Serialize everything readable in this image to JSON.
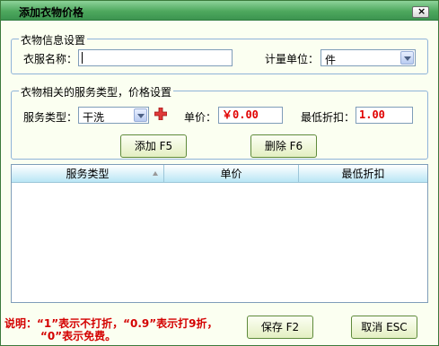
{
  "window": {
    "title": "添加衣物价格",
    "close_label": "×"
  },
  "info_group": {
    "title": "衣物信息设置",
    "name_label": "衣服名称：",
    "name_value": "",
    "unit_label": "计量单位：",
    "unit_value": "件"
  },
  "service_group": {
    "title": "衣物相关的服务类型，价格设置",
    "service_label": "服务类型：",
    "service_value": "干洗",
    "price_label": "单价：",
    "price_value": "￥0.00",
    "discount_label": "最低折扣：",
    "discount_value": "1.00",
    "add_button": "添加 F5",
    "delete_button": "删除 F6"
  },
  "table": {
    "columns": [
      "服务类型",
      "单价",
      "最低折扣"
    ],
    "rows": []
  },
  "footer": {
    "note_line1": "说明：“1”表示不打折，“0.9”表示打9折，",
    "note_line2": "“0”表示免费。",
    "save_button": "保存 F2",
    "cancel_button": "取消 ESC"
  },
  "colors": {
    "title_gradient": "#4ea85e",
    "price_text": "#e00000",
    "note_text": "#d40000",
    "button_border": "#5e8a3b"
  },
  "icons": [
    "close-icon",
    "chevron-down-icon",
    "add-plus-icon",
    "sort-asc-icon"
  ]
}
